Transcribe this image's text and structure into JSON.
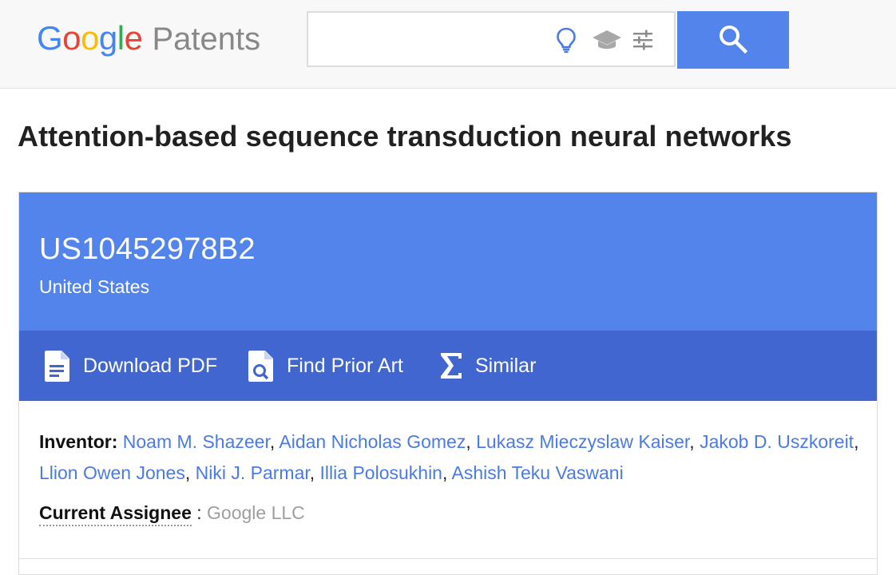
{
  "header": {
    "logo": {
      "letters": [
        "G",
        "o",
        "o",
        "g",
        "l",
        "e"
      ],
      "product": "Patents"
    },
    "search": {
      "value": "",
      "placeholder": ""
    },
    "icons": {
      "idea": "lightbulb-icon",
      "scholar": "graduation-cap-icon",
      "filters": "tune-sliders-icon",
      "search": "magnifier-icon"
    },
    "colors": {
      "search_button": "#5384ec",
      "idea_icon": "#4a7be4",
      "muted_icon": "#9e9e9e"
    }
  },
  "patent": {
    "title": "Attention-based sequence transduction neural networks",
    "publication_number": "US10452978B2",
    "country": "United States",
    "colors": {
      "header_bg": "#5384ec",
      "action_bar_bg": "#4266d0",
      "link": "#4a7be4"
    },
    "actions": [
      {
        "label": "Download PDF",
        "icon": "pdf-document-icon"
      },
      {
        "label": "Find Prior Art",
        "icon": "document-search-icon"
      },
      {
        "label": "Similar",
        "icon": "sigma-icon"
      }
    ],
    "inventor_label": "Inventor:",
    "inventors": [
      "Noam M. Shazeer",
      "Aidan Nicholas Gomez",
      "Lukasz Mieczyslaw Kaiser",
      "Jakob D. Uszkoreit",
      "Llion Owen Jones",
      "Niki J. Parmar",
      "Illia Polosukhin",
      "Ashish Teku Vaswani"
    ],
    "assignee_label": "Current Assignee",
    "assignee_colon": " : ",
    "assignee": "Google LLC"
  }
}
